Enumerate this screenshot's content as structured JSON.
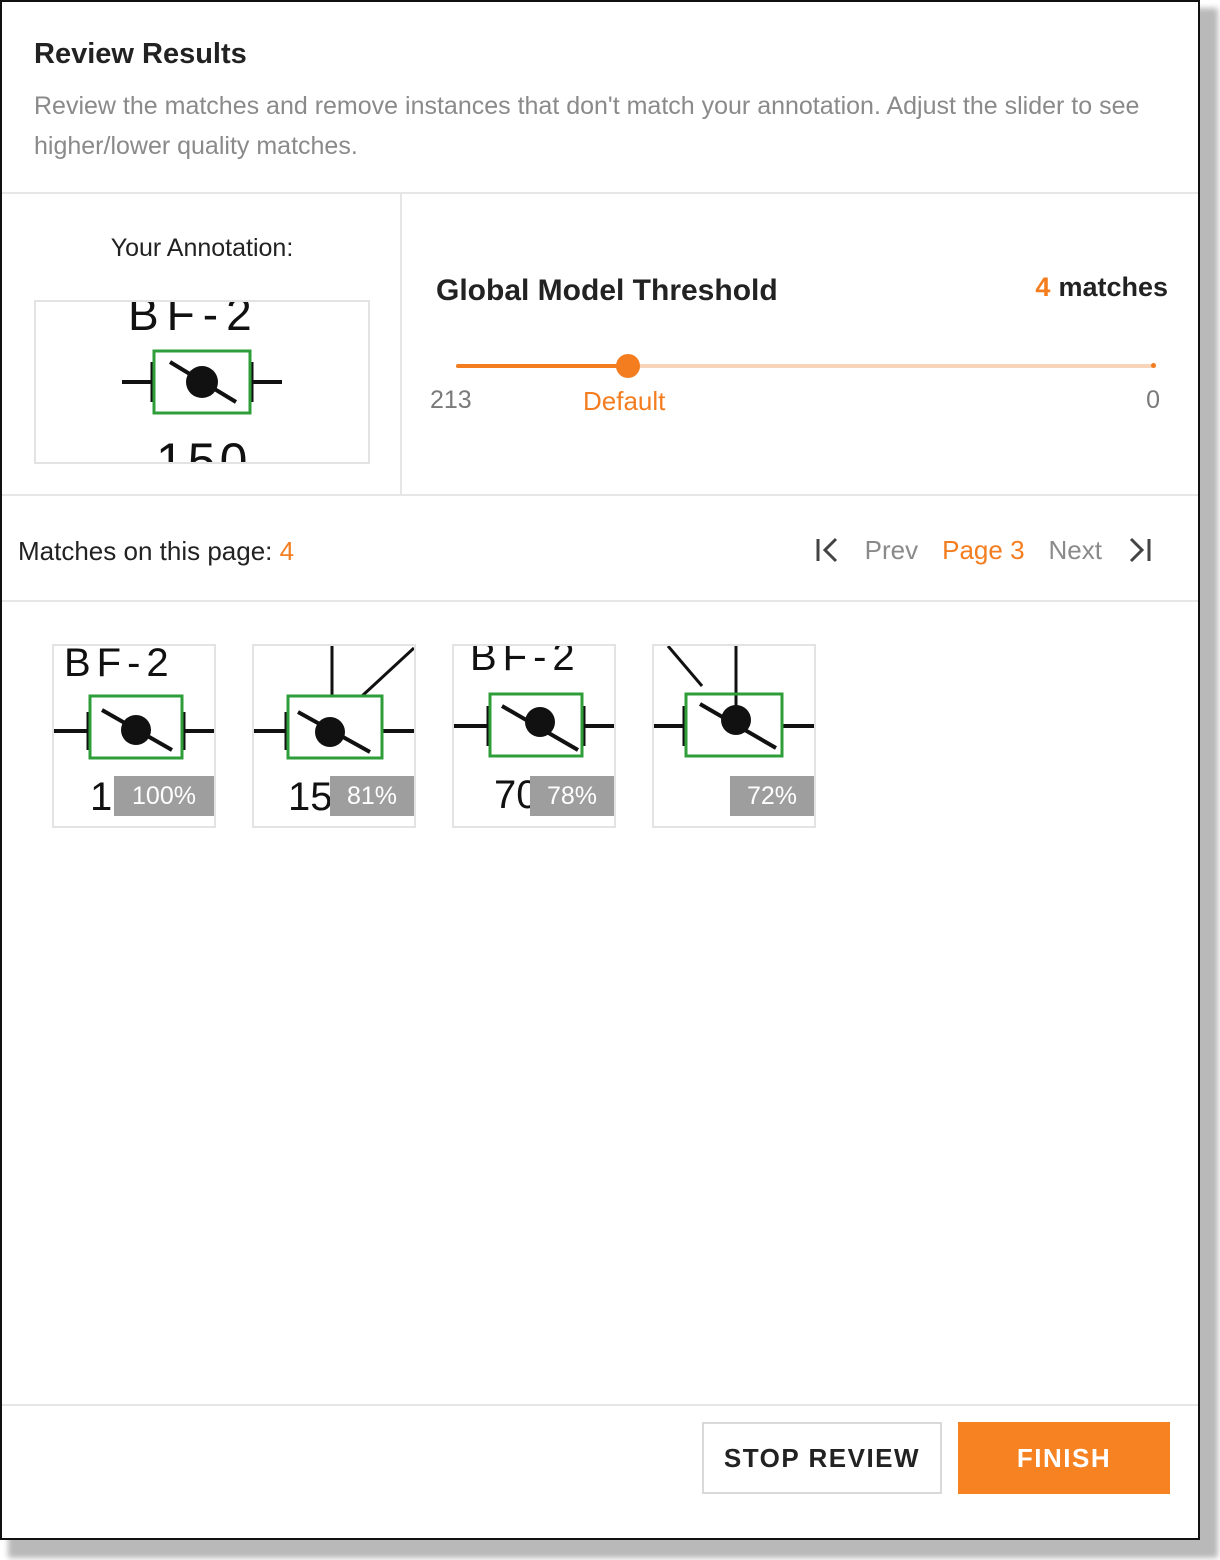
{
  "header": {
    "title": "Review Results",
    "subtitle": "Review the matches and remove instances that don't match your annotation. Adjust the slider to see higher/lower quality matches."
  },
  "annotation": {
    "label": "Your Annotation:",
    "top_text": "BF-2",
    "bottom_text": "150"
  },
  "threshold": {
    "title": "Global Model Threshold",
    "match_count": "4",
    "match_suffix": "matches",
    "slider_min_label": "213",
    "slider_default_label": "Default",
    "slider_max_label": "0",
    "slider_value_fraction": 0.245
  },
  "matches_page": {
    "label": "Matches on this page:",
    "count": "4",
    "prev_label": "Prev",
    "page_label": "Page 3",
    "next_label": "Next"
  },
  "thumbnails": [
    {
      "score": "100%",
      "top_text": "BF-2",
      "bottom_text": "1"
    },
    {
      "score": "81%",
      "top_text": "",
      "bottom_text": "15"
    },
    {
      "score": "78%",
      "top_text": "BF-2",
      "bottom_text": "70"
    },
    {
      "score": "72%",
      "top_text": "",
      "bottom_text": ""
    }
  ],
  "footer": {
    "stop_label": "STOP REVIEW",
    "finish_label": "FINISH"
  },
  "colors": {
    "accent": "#f47d20",
    "accent_light": "#f8d5b8",
    "muted_text": "#8a8a8a",
    "symbol_green": "#2e9e3a",
    "score_badge": "#9e9e9e"
  },
  "icons": {
    "first_page": "first-page-icon",
    "last_page": "last-page-icon"
  }
}
